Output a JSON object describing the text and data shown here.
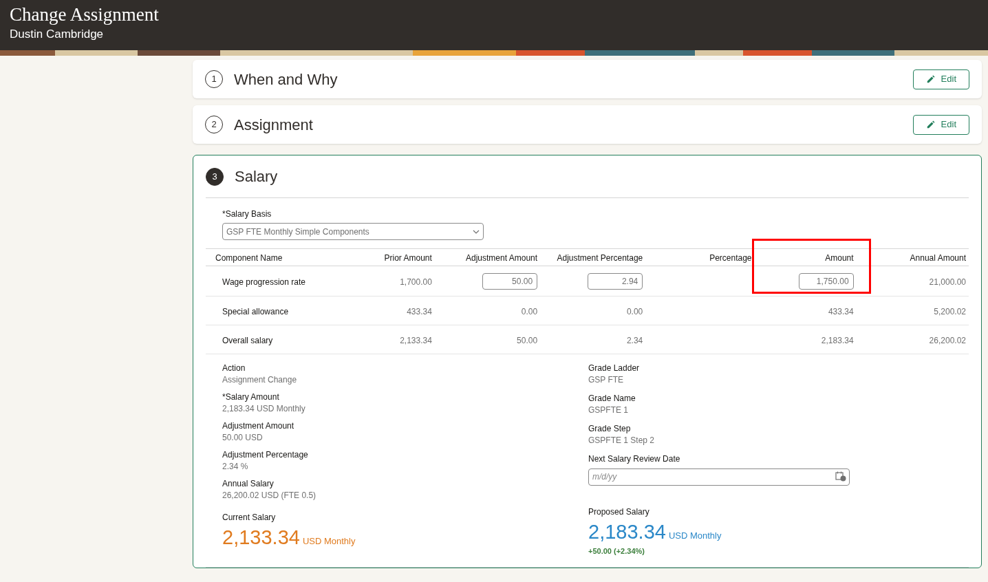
{
  "header": {
    "title": "Change Assignment",
    "subtitle": "Dustin Cambridge"
  },
  "sections": [
    {
      "number": "1",
      "title": "When and Why",
      "edit": "Edit",
      "active": false
    },
    {
      "number": "2",
      "title": "Assignment",
      "edit": "Edit",
      "active": false
    },
    {
      "number": "3",
      "title": "Salary",
      "active": true
    }
  ],
  "salary_basis": {
    "label": "*Salary Basis",
    "value": "GSP FTE Monthly Simple Components"
  },
  "table": {
    "columns": [
      "Component Name",
      "Prior Amount",
      "Adjustment Amount",
      "Adjustment Percentage",
      "Percentage",
      "Amount",
      "Annual Amount"
    ],
    "rows": [
      {
        "cells": [
          {
            "kind": "text",
            "value": "Wage progression rate"
          },
          {
            "kind": "text",
            "value": "1,700.00"
          },
          {
            "kind": "input",
            "value": "50.00"
          },
          {
            "kind": "input",
            "value": "2.94"
          },
          {
            "kind": "empty"
          },
          {
            "kind": "input",
            "value": "1,750.00"
          },
          {
            "kind": "text",
            "value": "21,000.00"
          }
        ]
      },
      {
        "cells": [
          {
            "kind": "text",
            "value": "Special allowance"
          },
          {
            "kind": "text",
            "value": "433.34"
          },
          {
            "kind": "text",
            "value": "0.00"
          },
          {
            "kind": "text",
            "value": "0.00"
          },
          {
            "kind": "empty"
          },
          {
            "kind": "text",
            "value": "433.34"
          },
          {
            "kind": "text",
            "value": "5,200.02"
          }
        ]
      },
      {
        "cells": [
          {
            "kind": "text",
            "value": "Overall salary"
          },
          {
            "kind": "text",
            "value": "2,133.34"
          },
          {
            "kind": "text",
            "value": "50.00"
          },
          {
            "kind": "text",
            "value": "2.34"
          },
          {
            "kind": "empty"
          },
          {
            "kind": "text",
            "value": "2,183.34"
          },
          {
            "kind": "text",
            "value": "26,200.02"
          }
        ]
      }
    ]
  },
  "details_left": [
    {
      "label": "Action",
      "value": [
        "Assignment Change"
      ]
    },
    {
      "label": "*Salary Amount",
      "value": [
        "2,183.34",
        "USD",
        "Monthly"
      ]
    },
    {
      "label": "Adjustment Amount",
      "value": [
        "50.00",
        "USD"
      ]
    },
    {
      "label": "Adjustment Percentage",
      "value": [
        "2.34",
        "%"
      ]
    },
    {
      "label": "Annual Salary",
      "value": [
        "26,200.02",
        "USD",
        "(FTE 0.5)"
      ]
    }
  ],
  "details_right": [
    {
      "label": "Grade Ladder",
      "value": [
        "GSP FTE"
      ]
    },
    {
      "label": "Grade Name",
      "value": [
        "GSPFTE 1"
      ]
    },
    {
      "label": "Grade Step",
      "value": [
        "GSPFTE 1 Step 2"
      ]
    }
  ],
  "review_date": {
    "label": "Next Salary Review Date",
    "placeholder": "m/d/yy"
  },
  "current_salary": {
    "label": "Current Salary",
    "amount": "2,133.34",
    "unit": "USD Monthly"
  },
  "proposed_salary": {
    "label": "Proposed Salary",
    "amount": "2,183.34",
    "unit": "USD Monthly",
    "change": "+50.00 (+2.34%)"
  }
}
